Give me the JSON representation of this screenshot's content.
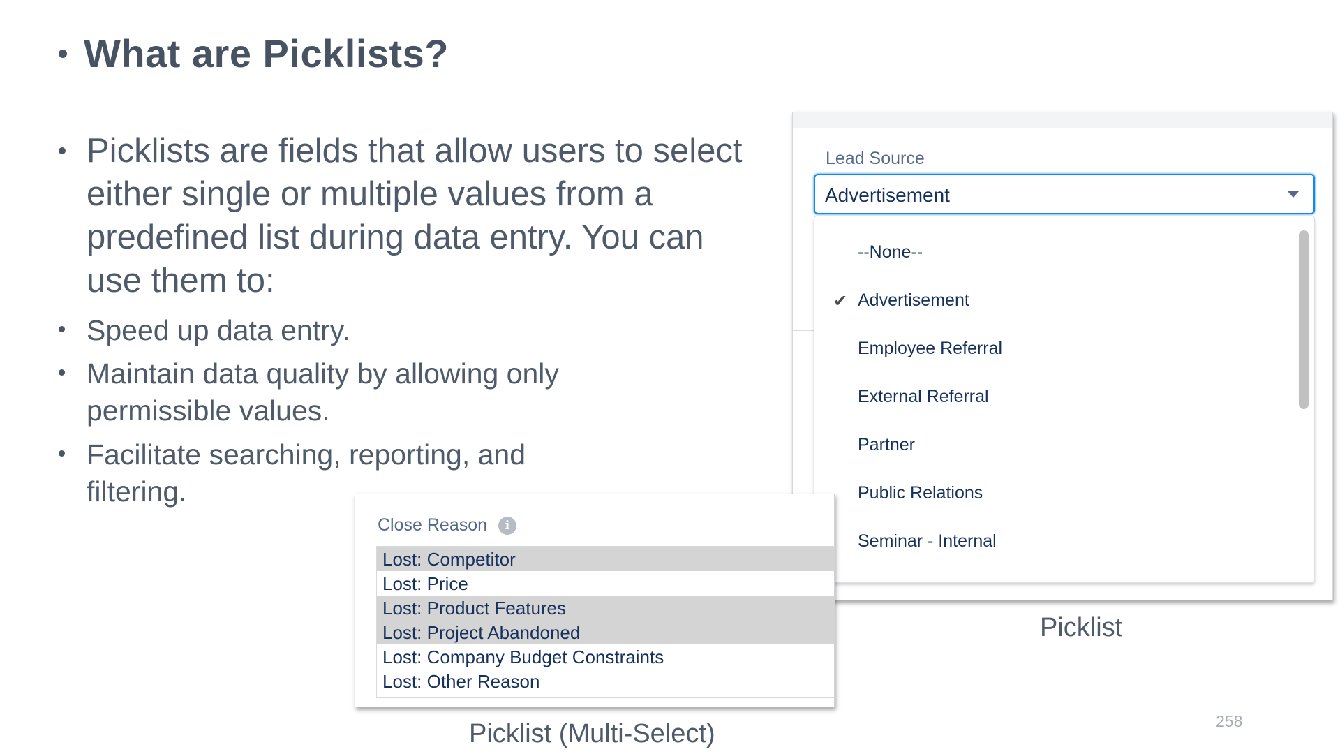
{
  "slide": {
    "title": "What are Picklists?",
    "intro": "Picklists are fields that allow users to select either single or multiple values from a predefined list during data entry. You can use them to:",
    "points": [
      "Speed up data entry.",
      "Maintain data quality by allowing only permissible values.",
      "Facilitate searching, reporting, and filtering."
    ],
    "page_number": "258"
  },
  "picklist": {
    "label": "Lead Source",
    "selected": "Advertisement",
    "check_glyph": "✔",
    "options": [
      "--None--",
      "Advertisement",
      "Employee Referral",
      "External Referral",
      "Partner",
      "Public Relations",
      "Seminar - Internal"
    ],
    "caption": "Picklist"
  },
  "multiselect": {
    "label": "Close Reason",
    "info_glyph": "i",
    "options": [
      {
        "label": "Lost: Competitor",
        "selected": true
      },
      {
        "label": "Lost: Price",
        "selected": false
      },
      {
        "label": "Lost: Product Features",
        "selected": true
      },
      {
        "label": "Lost: Project Abandoned",
        "selected": true
      },
      {
        "label": "Lost: Company Budget Constraints",
        "selected": false
      },
      {
        "label": "Lost: Other Reason",
        "selected": false
      }
    ],
    "caption": "Picklist (Multi-Select)"
  },
  "icons": {
    "bullet": "bullet-dot",
    "check": "checkmark-icon",
    "caret": "chevron-down-icon",
    "info": "info-icon"
  },
  "colors": {
    "text": "#4a5565",
    "focus_border": "#1589ee",
    "option_text": "#16325c",
    "field_label": "#54698d",
    "selected_row": "#d4d4d4"
  }
}
